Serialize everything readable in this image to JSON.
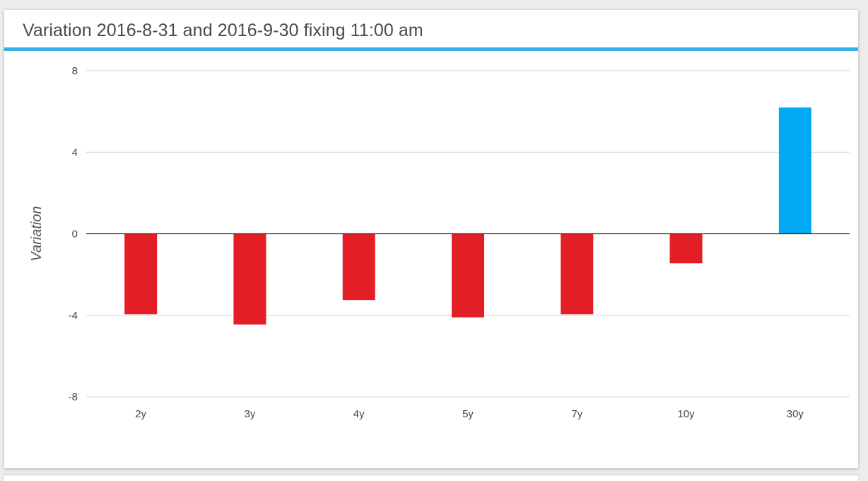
{
  "card": {
    "title": "Variation 2016-8-31 and 2016-9-30 fixing 11:00 am"
  },
  "colors": {
    "accent": "#3aafe4",
    "negative": "#e41e26",
    "positive": "#03a9f4",
    "grid": "#d6d6d6",
    "zero_line": "#222222",
    "tick_text": "#444444"
  },
  "chart_data": {
    "type": "bar",
    "title": "Variation 2016-8-31 and 2016-9-30 fixing 11:00 am",
    "xlabel": "",
    "ylabel": "Variation",
    "categories": [
      "2y",
      "3y",
      "4y",
      "5y",
      "7y",
      "10y",
      "30y"
    ],
    "values": [
      -3.95,
      -4.45,
      -3.25,
      -4.1,
      -3.95,
      -1.45,
      6.2
    ],
    "ylim": [
      -8,
      8
    ],
    "yticks": [
      8,
      4,
      0,
      -4,
      -8
    ],
    "ytick_labels": [
      "8",
      "4",
      "0",
      "-4",
      "-8"
    ],
    "grid": true,
    "legend": "none"
  }
}
